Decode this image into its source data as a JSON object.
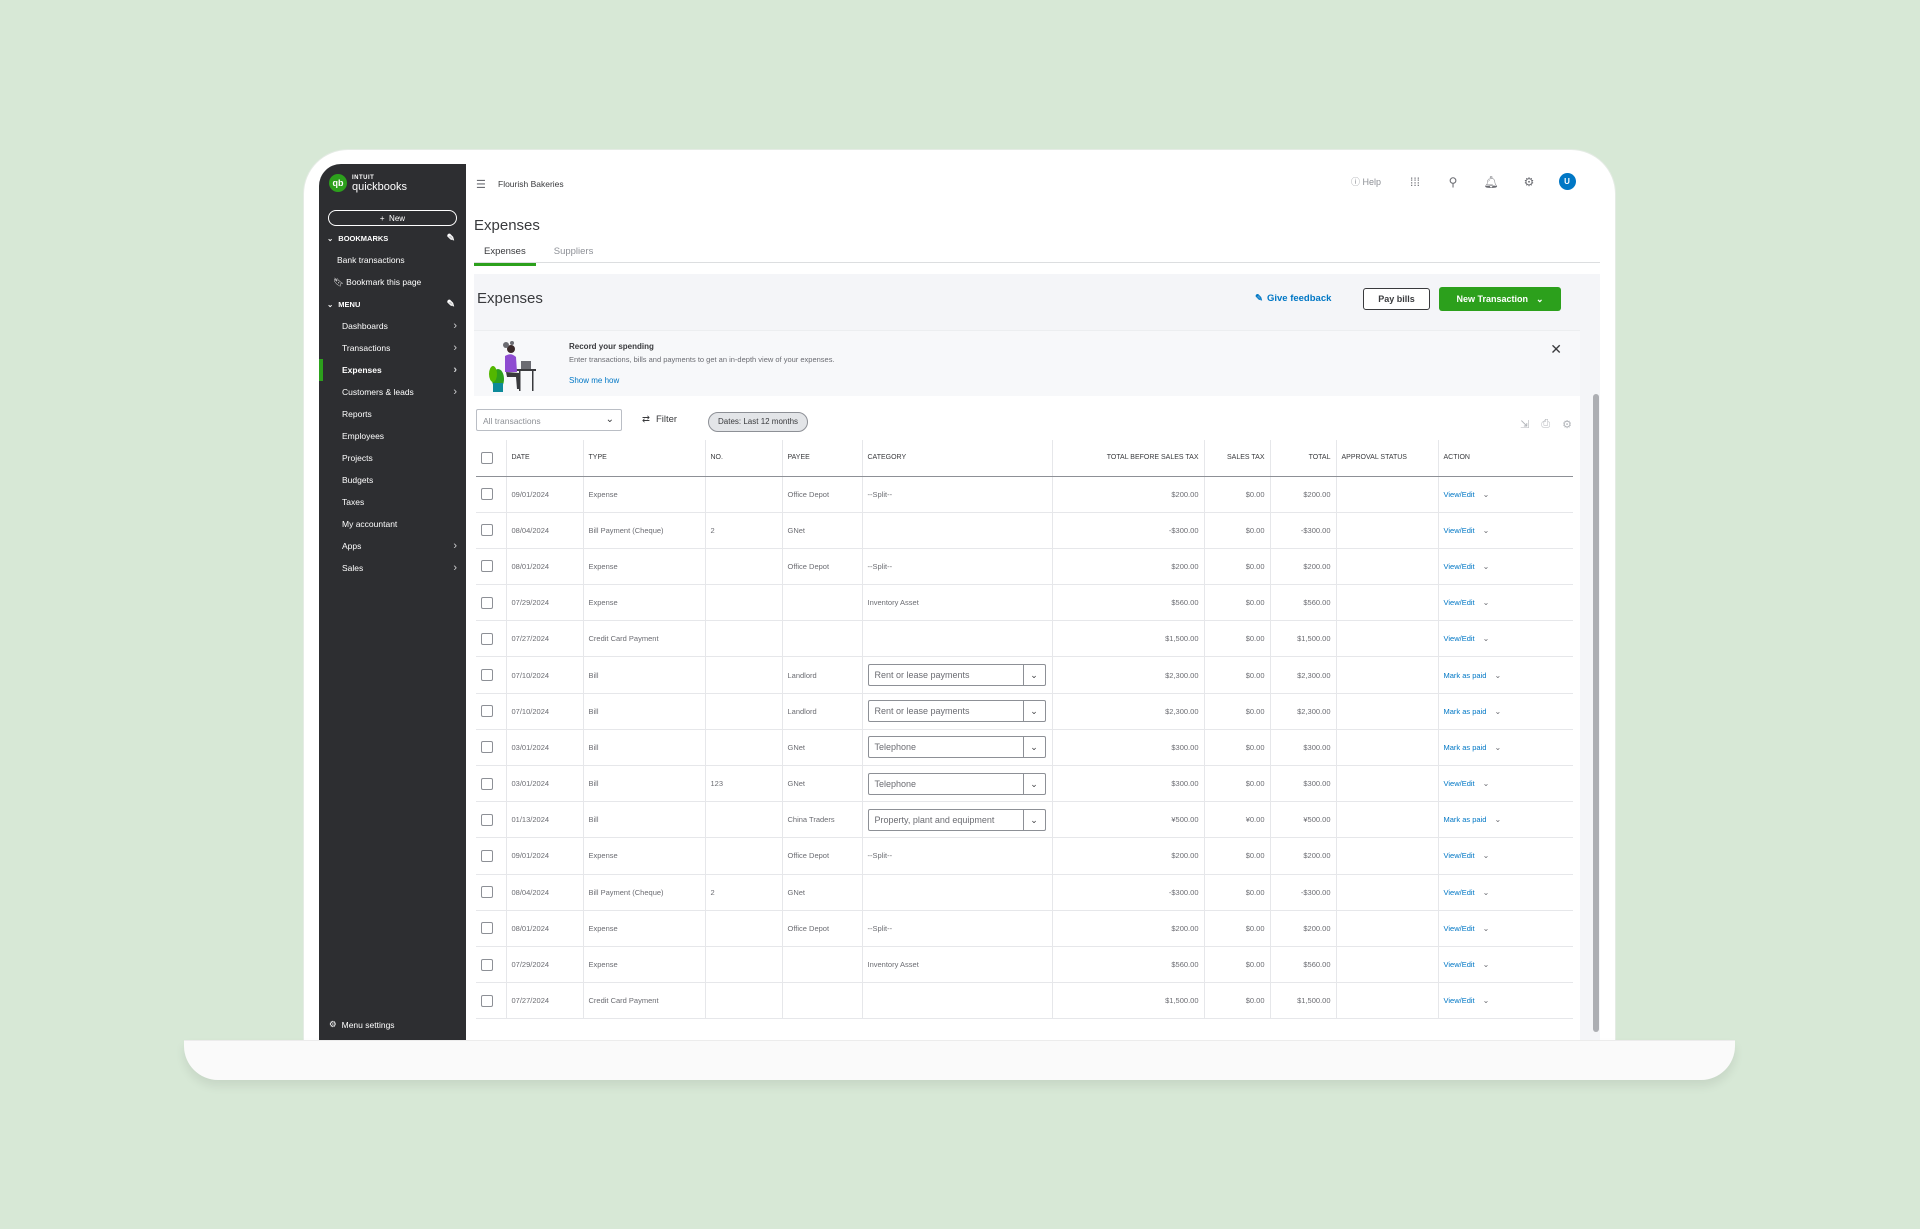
{
  "app": {
    "intuit": "INTUIT",
    "name": "quickbooks",
    "logo_glyph": "qb",
    "company": "Flourish Bakeries"
  },
  "sidebar": {
    "new_label": "New",
    "bookmarks_heading": "BOOKMARKS",
    "bookmarks": [
      "Bank transactions",
      "Bookmark this page"
    ],
    "menu_heading": "MENU",
    "items": [
      {
        "label": "Dashboards",
        "chevron": true
      },
      {
        "label": "Transactions",
        "chevron": true
      },
      {
        "label": "Expenses",
        "chevron": true,
        "active": true
      },
      {
        "label": "Customers & leads",
        "chevron": true
      },
      {
        "label": "Reports",
        "chevron": false
      },
      {
        "label": "Employees",
        "chevron": false
      },
      {
        "label": "Projects",
        "chevron": false
      },
      {
        "label": "Budgets",
        "chevron": false
      },
      {
        "label": "Taxes",
        "chevron": false
      },
      {
        "label": "My accountant",
        "chevron": false
      },
      {
        "label": "Apps",
        "chevron": true
      },
      {
        "label": "Sales",
        "chevron": true
      }
    ],
    "menu_settings": "Menu settings"
  },
  "header": {
    "help": "Help",
    "avatar": "U"
  },
  "page": {
    "title": "Expenses",
    "tabs": [
      "Expenses",
      "Suppliers"
    ],
    "section_title": "Expenses",
    "give_feedback": "Give feedback",
    "pay_bills": "Pay bills",
    "new_transaction": "New Transaction"
  },
  "banner": {
    "title": "Record your spending",
    "text": "Enter transactions, bills and payments to get an in-depth view of your expenses.",
    "link": "Show me how"
  },
  "filters": {
    "type_select": "All transactions",
    "filter_label": "Filter",
    "dates_pill": "Dates: Last 12 months"
  },
  "table": {
    "columns": [
      "DATE",
      "TYPE",
      "NO.",
      "PAYEE",
      "CATEGORY",
      "TOTAL BEFORE SALES TAX",
      "SALES TAX",
      "TOTAL",
      "APPROVAL STATUS",
      "ACTION"
    ],
    "rows": [
      {
        "date": "09/01/2024",
        "type": "Expense",
        "no": "",
        "payee": "Office Depot",
        "category": "--Split--",
        "category_select": false,
        "before_tax": "$200.00",
        "tax": "$0.00",
        "total": "$200.00",
        "action": "View/Edit"
      },
      {
        "date": "08/04/2024",
        "type": "Bill Payment (Cheque)",
        "no": "2",
        "payee": "GNet",
        "category": "",
        "category_select": false,
        "before_tax": "-$300.00",
        "tax": "$0.00",
        "total": "-$300.00",
        "action": "View/Edit"
      },
      {
        "date": "08/01/2024",
        "type": "Expense",
        "no": "",
        "payee": "Office Depot",
        "category": "--Split--",
        "category_select": false,
        "before_tax": "$200.00",
        "tax": "$0.00",
        "total": "$200.00",
        "action": "View/Edit"
      },
      {
        "date": "07/29/2024",
        "type": "Expense",
        "no": "",
        "payee": "",
        "category": "Inventory Asset",
        "category_select": false,
        "before_tax": "$560.00",
        "tax": "$0.00",
        "total": "$560.00",
        "action": "View/Edit"
      },
      {
        "date": "07/27/2024",
        "type": "Credit Card Payment",
        "no": "",
        "payee": "",
        "category": "",
        "category_select": false,
        "before_tax": "$1,500.00",
        "tax": "$0.00",
        "total": "$1,500.00",
        "action": "View/Edit"
      },
      {
        "date": "07/10/2024",
        "type": "Bill",
        "no": "",
        "payee": "Landlord",
        "category": "Rent or lease payments",
        "category_select": true,
        "before_tax": "$2,300.00",
        "tax": "$0.00",
        "total": "$2,300.00",
        "action": "Mark as paid"
      },
      {
        "date": "07/10/2024",
        "type": "Bill",
        "no": "",
        "payee": "Landlord",
        "category": "Rent or lease payments",
        "category_select": true,
        "before_tax": "$2,300.00",
        "tax": "$0.00",
        "total": "$2,300.00",
        "action": "Mark as paid"
      },
      {
        "date": "03/01/2024",
        "type": "Bill",
        "no": "",
        "payee": "GNet",
        "category": "Telephone",
        "category_select": true,
        "before_tax": "$300.00",
        "tax": "$0.00",
        "total": "$300.00",
        "action": "Mark as paid"
      },
      {
        "date": "03/01/2024",
        "type": "Bill",
        "no": "123",
        "payee": "GNet",
        "category": "Telephone",
        "category_select": true,
        "before_tax": "$300.00",
        "tax": "$0.00",
        "total": "$300.00",
        "action": "View/Edit"
      },
      {
        "date": "01/13/2024",
        "type": "Bill",
        "no": "",
        "payee": "China Traders",
        "category": "Property, plant and equipment",
        "category_select": true,
        "before_tax": "¥500.00",
        "tax": "¥0.00",
        "total": "¥500.00",
        "action": "Mark as paid"
      },
      {
        "date": "09/01/2024",
        "type": "Expense",
        "no": "",
        "payee": "Office Depot",
        "category": "--Split--",
        "category_select": false,
        "before_tax": "$200.00",
        "tax": "$0.00",
        "total": "$200.00",
        "action": "View/Edit"
      },
      {
        "date": "08/04/2024",
        "type": "Bill Payment (Cheque)",
        "no": "2",
        "payee": "GNet",
        "category": "",
        "category_select": false,
        "before_tax": "-$300.00",
        "tax": "$0.00",
        "total": "-$300.00",
        "action": "View/Edit"
      },
      {
        "date": "08/01/2024",
        "type": "Expense",
        "no": "",
        "payee": "Office Depot",
        "category": "--Split--",
        "category_select": false,
        "before_tax": "$200.00",
        "tax": "$0.00",
        "total": "$200.00",
        "action": "View/Edit"
      },
      {
        "date": "07/29/2024",
        "type": "Expense",
        "no": "",
        "payee": "",
        "category": "Inventory Asset",
        "category_select": false,
        "before_tax": "$560.00",
        "tax": "$0.00",
        "total": "$560.00",
        "action": "View/Edit"
      },
      {
        "date": "07/27/2024",
        "type": "Credit Card Payment",
        "no": "",
        "payee": "",
        "category": "",
        "category_select": false,
        "before_tax": "$1,500.00",
        "tax": "$0.00",
        "total": "$1,500.00",
        "action": "View/Edit"
      }
    ]
  },
  "colors": {
    "brand_green": "#2ca01c",
    "link_blue": "#0077c5",
    "sidebar_bg": "#2d2e31",
    "background": "#d7e8d6"
  },
  "icons": [
    "qb-logo-icon",
    "plus-icon",
    "pencil-icon",
    "bookmark-icon",
    "chevron-right-icon",
    "gear-icon",
    "hamburger-icon",
    "help-icon",
    "apps-grid-icon",
    "search-icon",
    "bell-icon",
    "feedback-icon",
    "chevron-down-icon",
    "close-icon",
    "sliders-icon",
    "export-icon",
    "print-icon"
  ]
}
